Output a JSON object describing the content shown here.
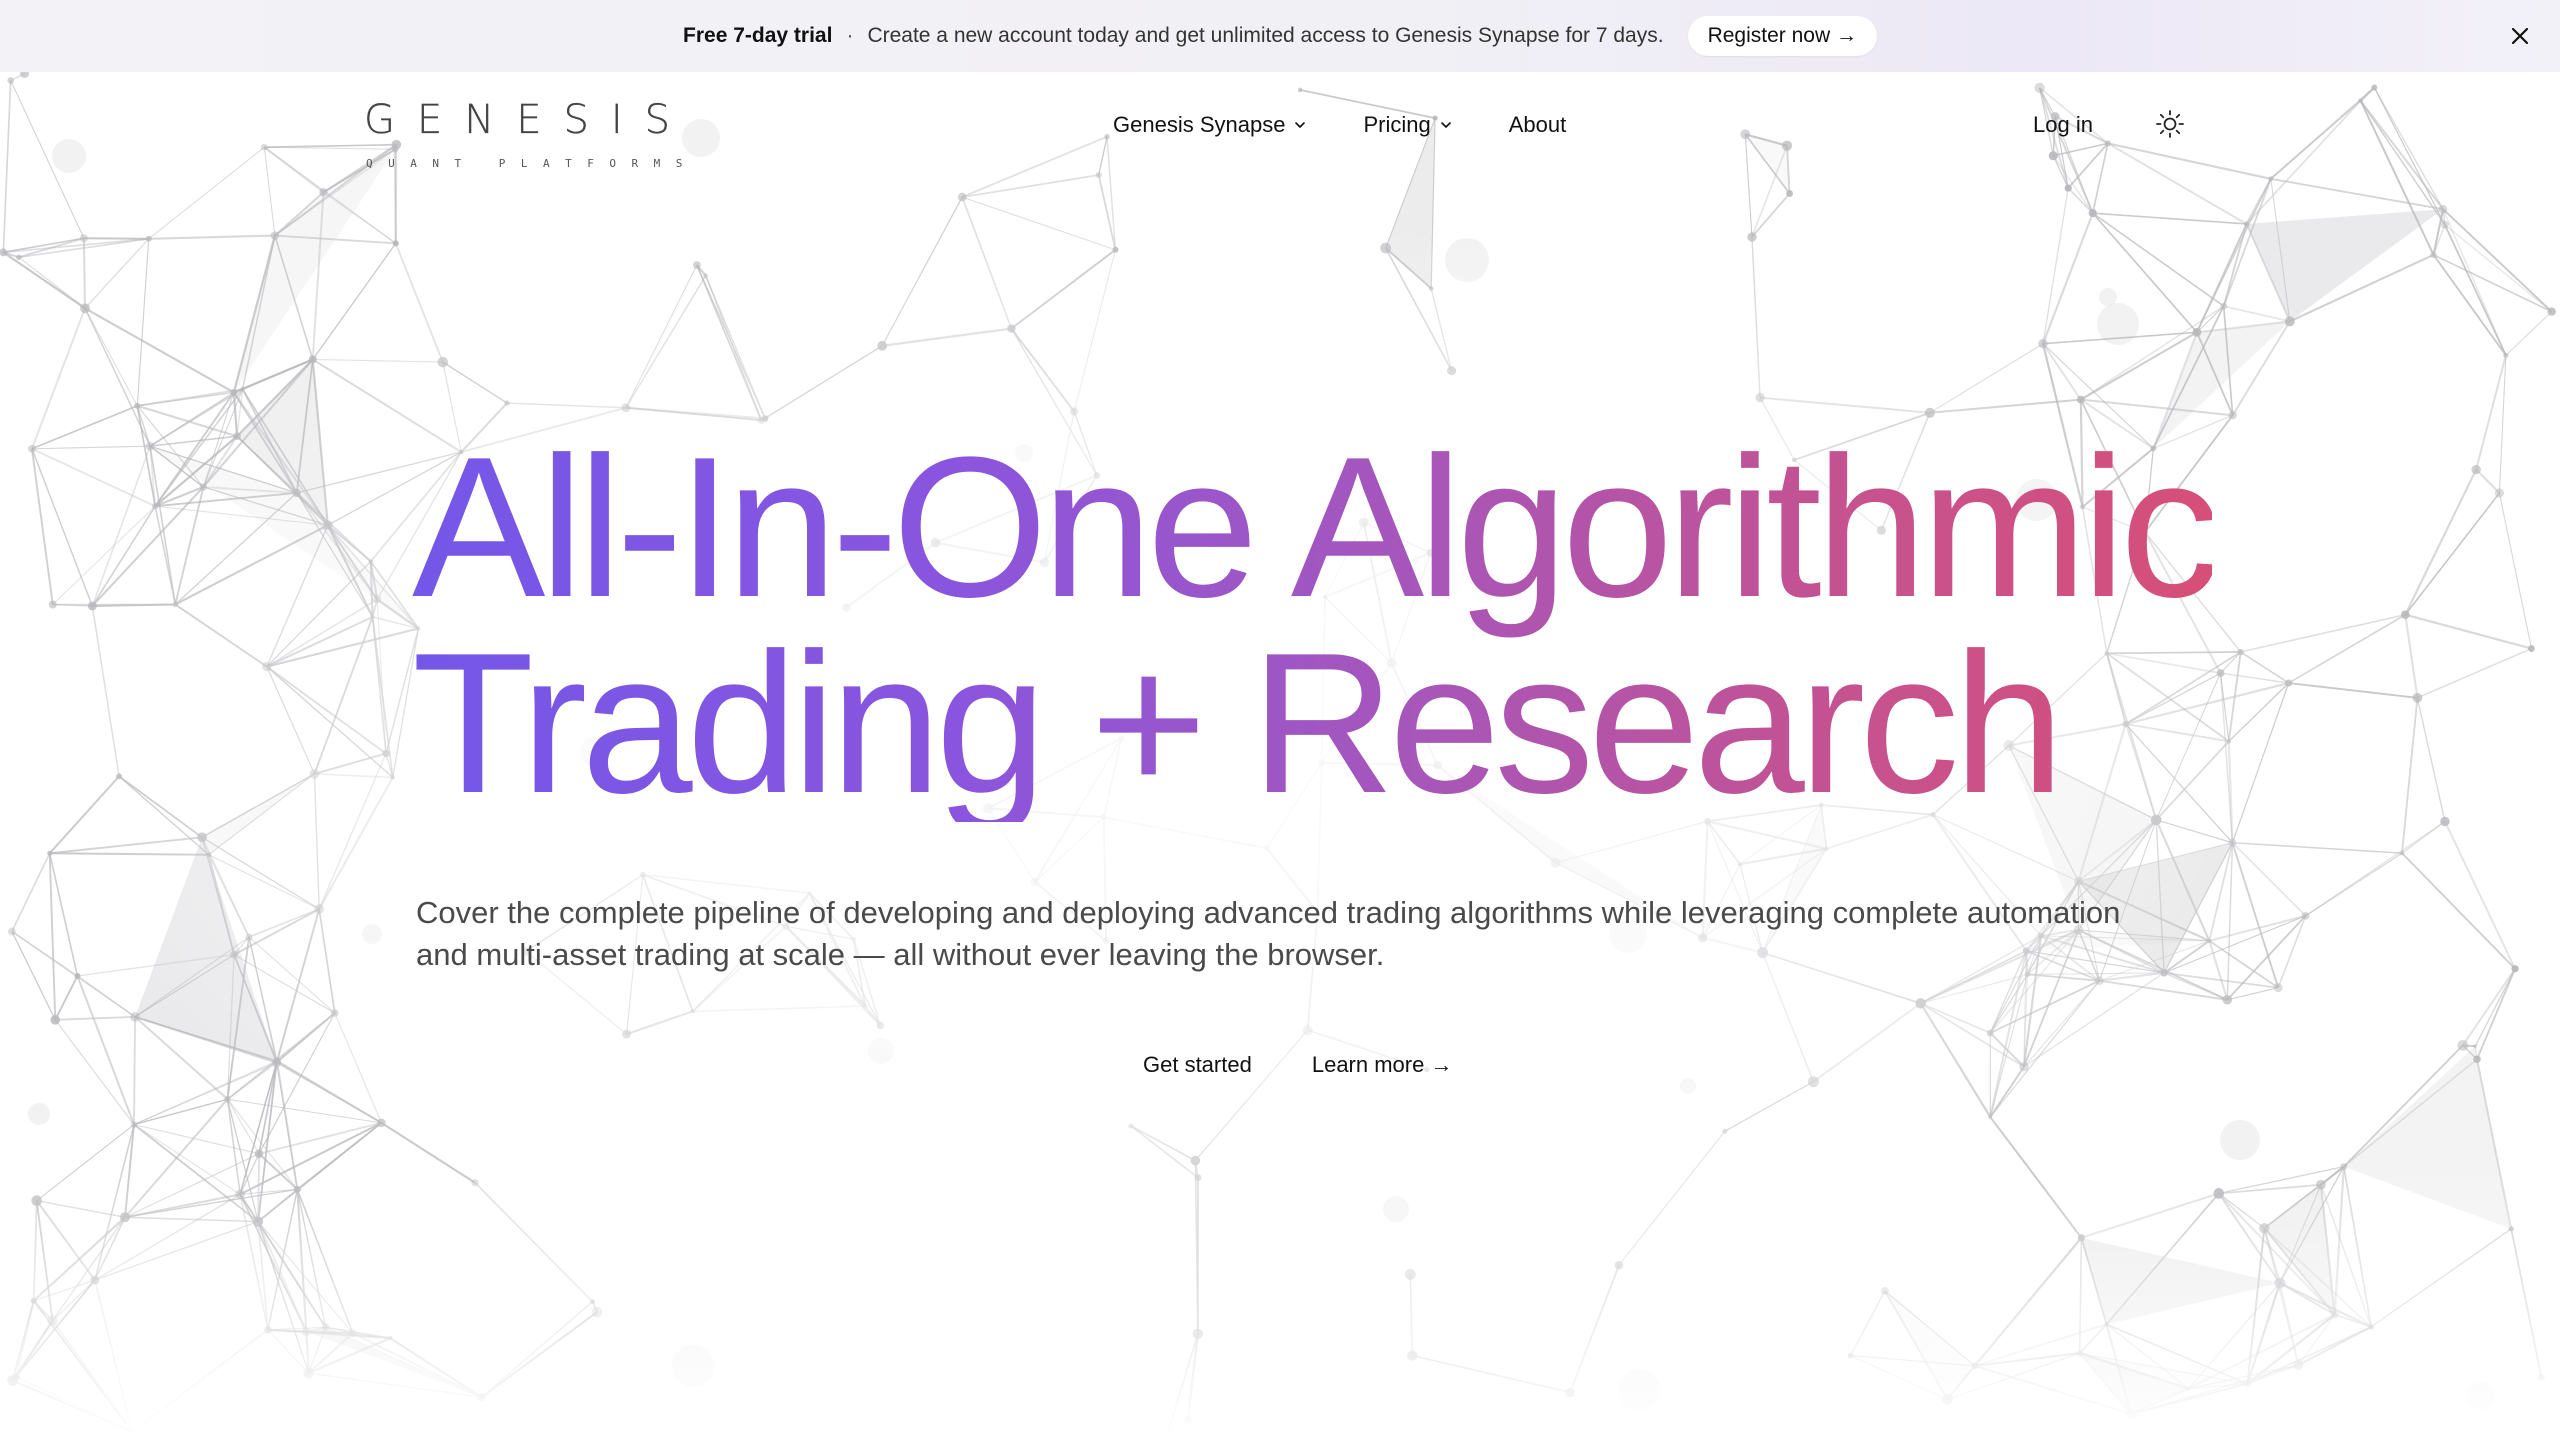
{
  "banner": {
    "bold_text": "Free 7-day trial",
    "separator": "·",
    "message": "Create a new account today and get unlimited access to Genesis Synapse for 7 days.",
    "cta_label": "Register now →",
    "close_icon": "close-icon"
  },
  "nav": {
    "logo": {
      "word": "GENESIS",
      "subtitle": "QUANT PLATFORMS"
    },
    "links": [
      {
        "label": "Genesis Synapse",
        "has_dropdown": true
      },
      {
        "label": "Pricing",
        "has_dropdown": true
      },
      {
        "label": "About",
        "has_dropdown": false
      }
    ],
    "login_label": "Log in",
    "theme_icon": "sun-icon"
  },
  "hero": {
    "title_line1": "All-In-One Algorithmic",
    "title_line2": "Trading + Research",
    "description": "Cover the complete pipeline of developing and deploying advanced trading algorithms while leveraging complete automation and multi-asset trading at scale — all without ever leaving the browser.",
    "primary_cta": "Get started",
    "secondary_cta": "Learn more →"
  },
  "colors": {
    "gradient_start": "#7457e8",
    "gradient_end": "#d64f78",
    "banner_bg": "#f1f0f5",
    "network_lines": "#b8b8bc"
  }
}
